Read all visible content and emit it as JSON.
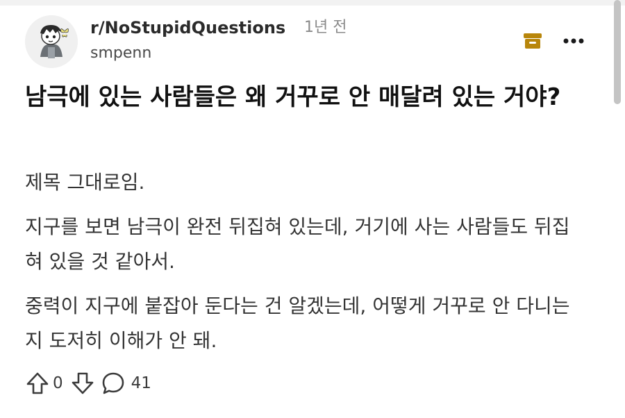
{
  "post": {
    "subreddit": "r/NoStupidQuestions",
    "time": "1년 전",
    "username": "smpenn",
    "title": "남극에 있는 사람들은 왜 거꾸로 안 매달려 있는 거야?",
    "paragraphs": [
      "제목 그대로임.",
      "지구를 보면 남극이 완전 뒤집혀 있는데, 거기에 사는 사람들도 뒤집혀 있을 것 같아서.",
      "중력이 지구에 붙잡아 둔다는 건 알겠는데, 어떻게 거꾸로 안 다니는지 도저히 이해가 안 돼."
    ],
    "upvote_count": "0",
    "comment_count": "41"
  },
  "icons": {
    "archive": "archive-icon",
    "more": "more-options-icon",
    "upvote": "upvote-arrow-icon",
    "downvote": "downvote-arrow-icon",
    "comment": "comment-bubble-icon"
  },
  "colors": {
    "archive_icon": "#b8860b",
    "text_primary": "#111111",
    "text_secondary": "#8a8a8a"
  }
}
